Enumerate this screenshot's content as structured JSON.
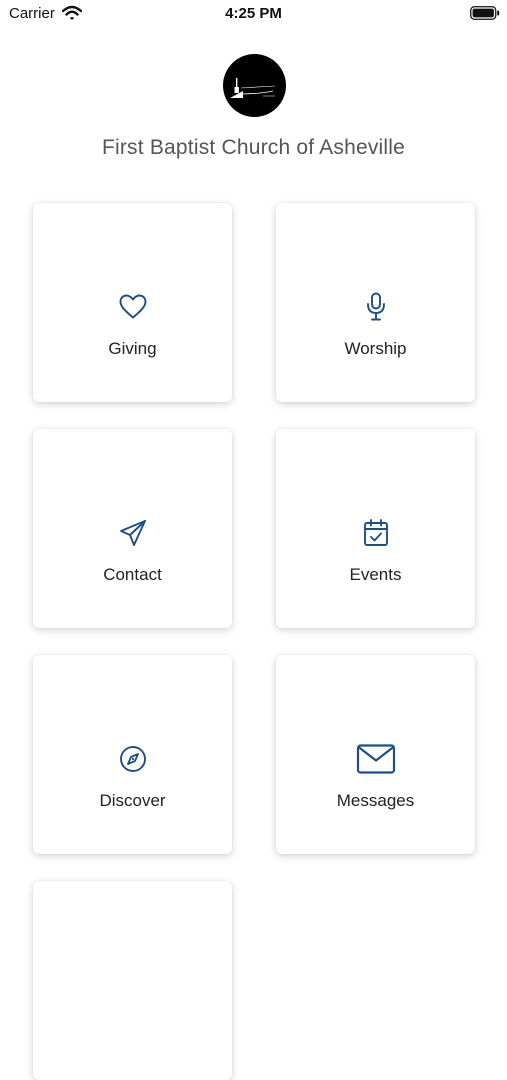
{
  "status_bar": {
    "carrier": "Carrier",
    "time": "4:25 PM"
  },
  "header": {
    "logo_icon": "church-logo",
    "church_name": "First Baptist Church of Asheville"
  },
  "accent_color": "#1f4e82",
  "tiles": [
    {
      "label": "Giving",
      "icon": "heart-icon"
    },
    {
      "label": "Worship",
      "icon": "microphone-icon"
    },
    {
      "label": "Contact",
      "icon": "paper-plane-icon"
    },
    {
      "label": "Events",
      "icon": "calendar-check-icon"
    },
    {
      "label": "Discover",
      "icon": "compass-icon"
    },
    {
      "label": "Messages",
      "icon": "envelope-icon"
    }
  ]
}
